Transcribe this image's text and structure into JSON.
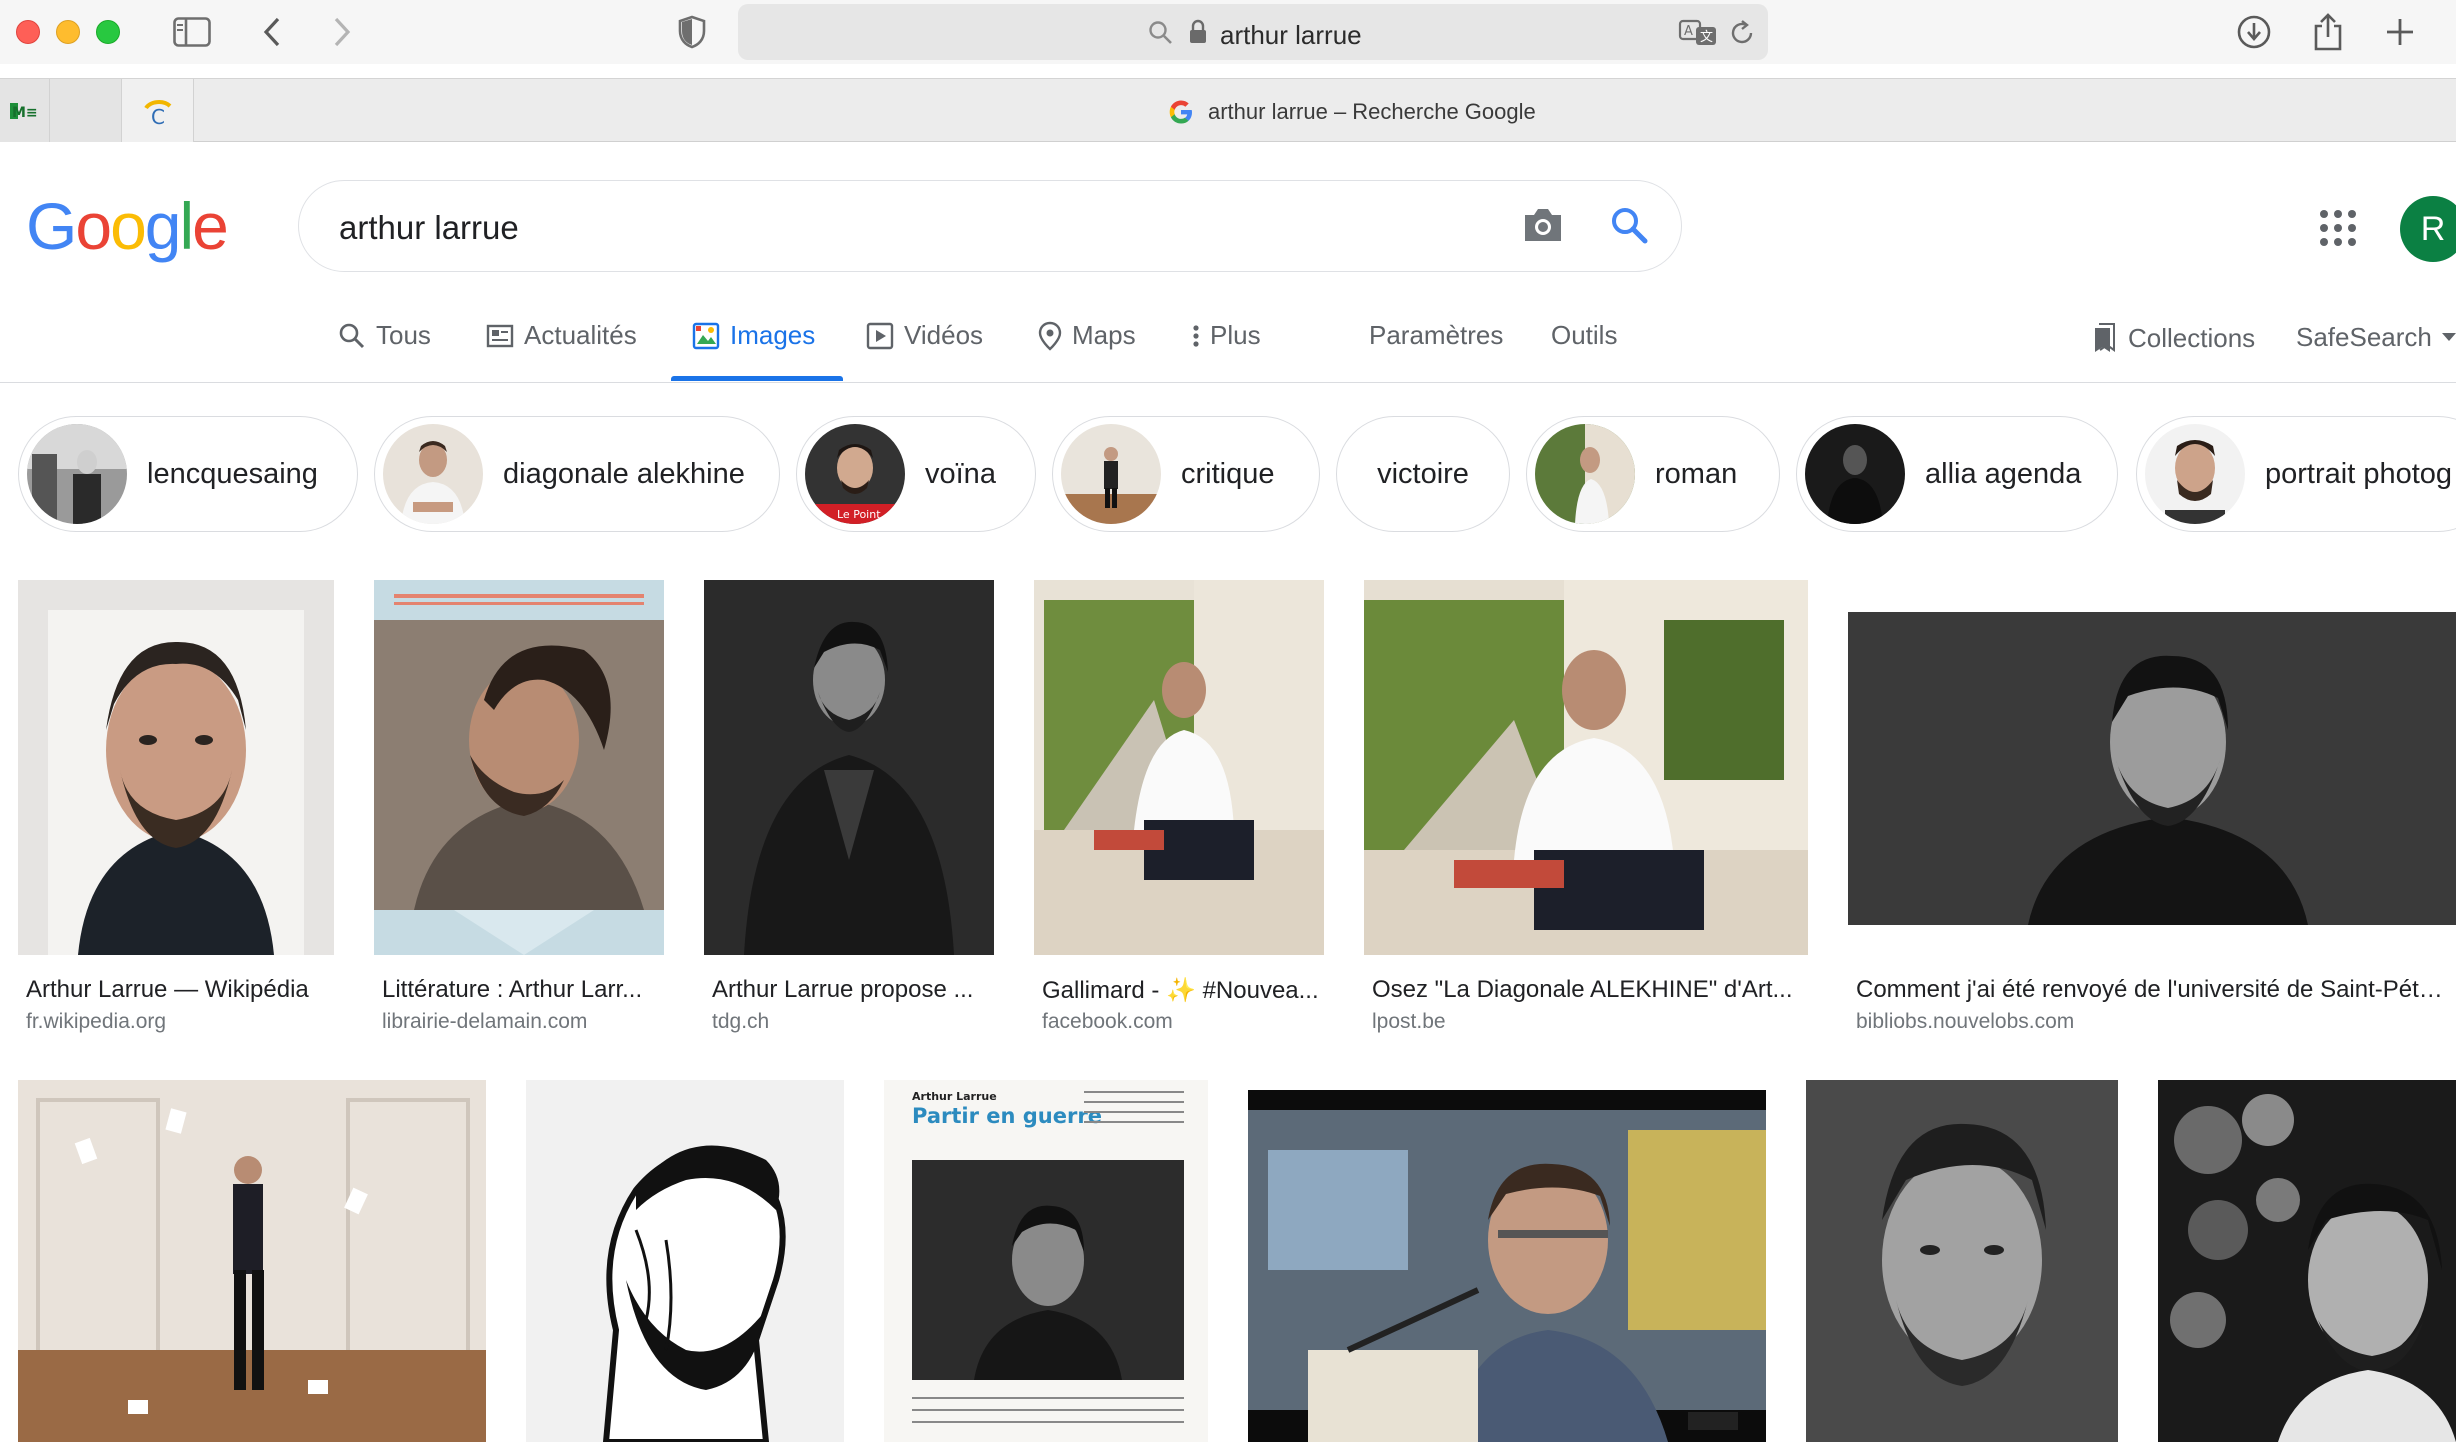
{
  "browser": {
    "address": "arthur larrue",
    "tab_title": "arthur larrue – Recherche Google"
  },
  "google": {
    "logo": "Google",
    "query": "arthur larrue",
    "avatar_initial": "R",
    "tabs": [
      {
        "label": "Tous",
        "icon": "search-icon"
      },
      {
        "label": "Actualités",
        "icon": "news-icon"
      },
      {
        "label": "Images",
        "icon": "image-icon"
      },
      {
        "label": "Vidéos",
        "icon": "video-icon"
      },
      {
        "label": "Maps",
        "icon": "map-pin-icon"
      },
      {
        "label": "Plus",
        "icon": "more-vert-icon"
      }
    ],
    "active_tab": "Images",
    "settings": "Paramètres",
    "tools": "Outils",
    "collections": "Collections",
    "safesearch": "SafeSearch"
  },
  "chips": [
    "lencquesaing",
    "diagonale alekhine",
    "voïna",
    "critique",
    "victoire",
    "roman",
    "allia agenda",
    "portrait photog"
  ],
  "results": [
    {
      "title": "Arthur Larrue — Wikipédia",
      "source": "fr.wikipedia.org"
    },
    {
      "title": "Littérature : Arthur Larr...",
      "source": "librairie-delamain.com"
    },
    {
      "title": "Arthur Larrue propose ...",
      "source": "tdg.ch"
    },
    {
      "title": "Gallimard - ✨ #Nouvea...",
      "source": "facebook.com"
    },
    {
      "title": "Osez \"La Diagonale ALEKHINE\" d'Art...",
      "source": "lpost.be"
    },
    {
      "title": "Comment j'ai été renvoyé de l'université de Saint-Péter...",
      "source": "bibliobs.nouvelobs.com"
    }
  ],
  "thumb_texts": {
    "lepoint": "Le Point",
    "magazine_author": "Arthur Larrue",
    "magazine_title": "Partir en guerre"
  }
}
